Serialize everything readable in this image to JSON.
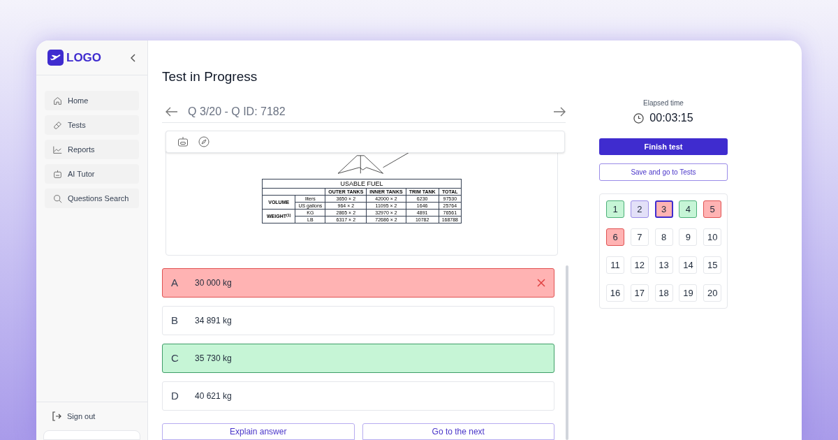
{
  "sidebar": {
    "logo": "LOGO",
    "items": [
      {
        "label": "Home"
      },
      {
        "label": "Tests"
      },
      {
        "label": "Reports"
      },
      {
        "label": "AI Tutor"
      },
      {
        "label": "Questions Search"
      }
    ],
    "sign_out": "Sign out"
  },
  "page_title": "Test in Progress",
  "question": {
    "heading": "Q 3/20 - Q ID: 7182",
    "figure": {
      "title": "USABLE FUEL",
      "columns": [
        "OUTER TANKS",
        "INNER TANKS",
        "TRIM TANK",
        "TOTAL"
      ],
      "groups": [
        {
          "label": "VOLUME",
          "rows": [
            {
              "unit": "liters",
              "cells": [
                "3650 × 2",
                "42000 × 2",
                "6230",
                "97530"
              ]
            },
            {
              "unit": "US gallons",
              "cells": [
                "964 × 2",
                "11095 × 2",
                "1646",
                "25764"
              ]
            }
          ]
        },
        {
          "label": "WEIGHT",
          "mark": "(1)",
          "rows": [
            {
              "unit": "KG",
              "cells": [
                "2865 × 2",
                "32970 × 2",
                "4891",
                "76561"
              ]
            },
            {
              "unit": "LB",
              "cells": [
                "6317 × 2",
                "72686 × 2",
                "10782",
                "168788"
              ]
            }
          ]
        }
      ]
    },
    "answers": [
      {
        "letter": "A",
        "text": "30 000 kg",
        "kind": "wrong"
      },
      {
        "letter": "B",
        "text": "34 891 kg",
        "kind": "plain"
      },
      {
        "letter": "C",
        "text": "35 730 kg",
        "kind": "correct"
      },
      {
        "letter": "D",
        "text": "40 621 kg",
        "kind": "plain"
      }
    ],
    "buttons": [
      "Explain answer",
      "Go to the next"
    ]
  },
  "timer": {
    "label": "Elapsed time",
    "value": "00:03:15"
  },
  "finish_button": "Finish test",
  "save_button": "Save and go to Tests",
  "question_grid": [
    {
      "number": "1",
      "kind": "correct",
      "selected": false
    },
    {
      "number": "2",
      "kind": "flagged",
      "selected": false
    },
    {
      "number": "3",
      "kind": "wrong",
      "selected": true
    },
    {
      "number": "4",
      "kind": "correct",
      "selected": false
    },
    {
      "number": "5",
      "kind": "wrong",
      "selected": false
    },
    {
      "number": "6",
      "kind": "wrong",
      "selected": false
    },
    {
      "number": "7",
      "kind": "plain",
      "selected": false
    },
    {
      "number": "8",
      "kind": "plain",
      "selected": false
    },
    {
      "number": "9",
      "kind": "plain",
      "selected": false
    },
    {
      "number": "10",
      "kind": "plain",
      "selected": false
    },
    {
      "number": "11",
      "kind": "plain",
      "selected": false
    },
    {
      "number": "12",
      "kind": "plain",
      "selected": false
    },
    {
      "number": "13",
      "kind": "plain",
      "selected": false
    },
    {
      "number": "14",
      "kind": "plain",
      "selected": false
    },
    {
      "number": "15",
      "kind": "plain",
      "selected": false
    },
    {
      "number": "16",
      "kind": "plain",
      "selected": false
    },
    {
      "number": "17",
      "kind": "plain",
      "selected": false
    },
    {
      "number": "18",
      "kind": "plain",
      "selected": false
    },
    {
      "number": "19",
      "kind": "plain",
      "selected": false
    },
    {
      "number": "20",
      "kind": "plain",
      "selected": false
    }
  ]
}
